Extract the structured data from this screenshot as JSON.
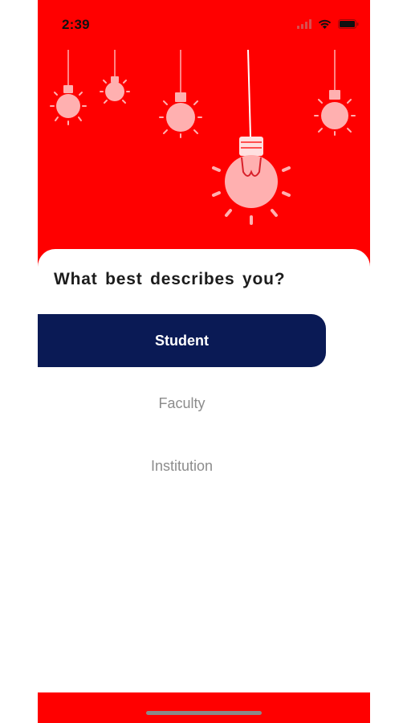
{
  "status_bar": {
    "time": "2:39",
    "icons": [
      "cellular-icon",
      "wifi-icon",
      "battery-icon"
    ]
  },
  "hero": {
    "background_color": "#ff0000",
    "illustration": "light-bulbs-icon"
  },
  "sheet": {
    "title": "What best describes you?",
    "options": [
      {
        "label": "Student",
        "selected": true
      },
      {
        "label": "Faculty",
        "selected": false
      },
      {
        "label": "Institution",
        "selected": false
      }
    ]
  },
  "colors": {
    "accent": "#ff0000",
    "selected_background": "#0a1a55",
    "selected_text": "#ffffff",
    "unselected_text": "#8c8c8c"
  }
}
